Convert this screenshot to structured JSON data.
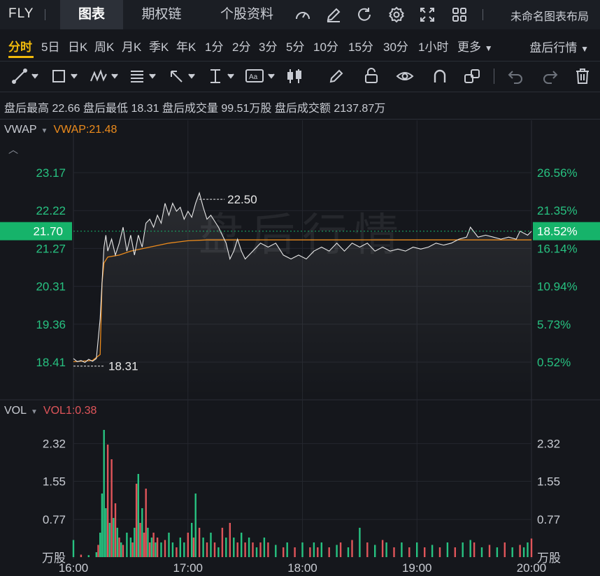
{
  "ticker": "FLY",
  "tabs": [
    "图表",
    "期权链",
    "个股资料"
  ],
  "layout_name": "未命名图表布局",
  "periods": [
    "分时",
    "5日",
    "日K",
    "周K",
    "月K",
    "季K",
    "年K",
    "1分",
    "2分",
    "3分",
    "5分",
    "10分",
    "15分",
    "30分",
    "1小时",
    "更多"
  ],
  "active_period": "分时",
  "after_hours_label": "盘后行情",
  "stats": [
    {
      "label": "盘后最高",
      "value": "22.66"
    },
    {
      "label": "盘后最低",
      "value": "18.31"
    },
    {
      "label": "盘后成交量",
      "value": "99.51万股"
    },
    {
      "label": "盘后成交额",
      "value": "2137.87万"
    }
  ],
  "indicators": {
    "price": {
      "name": "VWAP",
      "value_label": "VWAP:21.48"
    },
    "volume": {
      "name": "VOL",
      "value_label": "VOL1:0.38"
    }
  },
  "watermark": "盘后行情",
  "icons": {
    "top": [
      "gauge-icon",
      "edit-icon",
      "refresh-icon",
      "settings-icon",
      "fullscreen-icon",
      "grid-layout-icon"
    ],
    "tools": [
      "trendline-icon",
      "rectangle-icon",
      "wave-icon",
      "fib-icon",
      "arrow-icon",
      "measure-icon",
      "text-icon",
      "candle-icon",
      "pen-icon",
      "lock-icon",
      "eye-icon",
      "magnet-icon",
      "link-icon",
      "undo-icon",
      "redo-icon",
      "trash-icon"
    ]
  },
  "colors": {
    "accent": "#f0b90b",
    "up": "#27c281",
    "down": "#e0555a",
    "vwap": "#ec8b1c",
    "price_line": "#e8e8e8",
    "current_price_tag": "#16b36a"
  },
  "chart_data": {
    "type": "line",
    "x_ticks": [
      "16:00",
      "17:00",
      "18:00",
      "19:00",
      "20:00"
    ],
    "y_ticks_left": [
      "23.17",
      "22.22",
      "21.27",
      "20.31",
      "19.36",
      "18.41"
    ],
    "y_ticks_right": [
      "26.56%",
      "21.35%",
      "16.14%",
      "10.94%",
      "5.73%",
      "0.52%"
    ],
    "ylim": [
      18.41,
      23.17
    ],
    "last_price": "21.70",
    "last_pct": "18.52%",
    "high_label": "22.50",
    "low_label": "18.31",
    "series": [
      {
        "name": "price",
        "points": [
          [
            "16:00",
            18.5
          ],
          [
            "16:02",
            18.42
          ],
          [
            "16:04",
            18.45
          ],
          [
            "16:06",
            18.4
          ],
          [
            "16:08",
            18.48
          ],
          [
            "16:10",
            18.43
          ],
          [
            "16:12",
            18.5
          ],
          [
            "16:14",
            19.5
          ],
          [
            "16:15",
            20.4
          ],
          [
            "16:16",
            21.3
          ],
          [
            "16:17",
            21.6
          ],
          [
            "16:18",
            21.2
          ],
          [
            "16:20",
            21.5
          ],
          [
            "16:22",
            21.1
          ],
          [
            "16:24",
            21.4
          ],
          [
            "16:26",
            21.8
          ],
          [
            "16:28",
            21.2
          ],
          [
            "16:30",
            21.6
          ],
          [
            "16:32",
            21.1
          ],
          [
            "16:34",
            21.6
          ],
          [
            "16:36",
            21.3
          ],
          [
            "16:38",
            21.9
          ],
          [
            "16:40",
            22.0
          ],
          [
            "16:42",
            21.8
          ],
          [
            "16:44",
            22.1
          ],
          [
            "16:46",
            21.9
          ],
          [
            "16:48",
            22.4
          ],
          [
            "16:50",
            22.1
          ],
          [
            "16:52",
            22.4
          ],
          [
            "16:54",
            22.2
          ],
          [
            "16:56",
            22.3
          ],
          [
            "16:58",
            22.0
          ],
          [
            "17:00",
            22.2
          ],
          [
            "17:02",
            22.05
          ],
          [
            "17:04",
            22.4
          ],
          [
            "17:06",
            22.66
          ],
          [
            "17:08",
            22.3
          ],
          [
            "17:10",
            22.0
          ],
          [
            "17:12",
            22.1
          ],
          [
            "17:14",
            21.95
          ],
          [
            "17:16",
            21.8
          ],
          [
            "17:18",
            21.6
          ],
          [
            "17:20",
            21.4
          ],
          [
            "17:22",
            21.0
          ],
          [
            "17:24",
            21.2
          ],
          [
            "17:26",
            21.5
          ],
          [
            "17:28",
            21.2
          ],
          [
            "17:30",
            21.0
          ],
          [
            "17:34",
            21.2
          ],
          [
            "17:38",
            21.4
          ],
          [
            "17:42",
            21.3
          ],
          [
            "17:46",
            21.4
          ],
          [
            "17:50",
            21.1
          ],
          [
            "17:54",
            21.0
          ],
          [
            "17:58",
            21.1
          ],
          [
            "18:02",
            21.0
          ],
          [
            "18:06",
            21.2
          ],
          [
            "18:10",
            21.3
          ],
          [
            "18:14",
            21.2
          ],
          [
            "18:18",
            21.4
          ],
          [
            "18:22",
            21.2
          ],
          [
            "18:26",
            21.4
          ],
          [
            "18:30",
            21.3
          ],
          [
            "18:34",
            21.4
          ],
          [
            "18:38",
            21.2
          ],
          [
            "18:42",
            21.3
          ],
          [
            "18:46",
            21.2
          ],
          [
            "18:50",
            21.25
          ],
          [
            "18:54",
            21.2
          ],
          [
            "18:58",
            21.3
          ],
          [
            "19:02",
            21.25
          ],
          [
            "19:06",
            21.3
          ],
          [
            "19:10",
            21.4
          ],
          [
            "19:14",
            21.35
          ],
          [
            "19:18",
            21.4
          ],
          [
            "19:22",
            21.5
          ],
          [
            "19:26",
            21.55
          ],
          [
            "19:28",
            21.8
          ],
          [
            "19:32",
            21.55
          ],
          [
            "19:36",
            21.6
          ],
          [
            "19:40",
            21.55
          ],
          [
            "19:44",
            21.5
          ],
          [
            "19:48",
            21.55
          ],
          [
            "19:52",
            21.5
          ],
          [
            "19:54",
            21.7
          ],
          [
            "19:58",
            21.6
          ],
          [
            "20:00",
            21.7
          ]
        ]
      },
      {
        "name": "VWAP",
        "points": [
          [
            "16:00",
            18.42
          ],
          [
            "16:10",
            18.45
          ],
          [
            "16:14",
            18.6
          ],
          [
            "16:15",
            20.4
          ],
          [
            "16:16",
            20.9
          ],
          [
            "16:18",
            21.05
          ],
          [
            "16:24",
            21.1
          ],
          [
            "16:30",
            21.2
          ],
          [
            "16:40",
            21.3
          ],
          [
            "16:50",
            21.4
          ],
          [
            "17:00",
            21.46
          ],
          [
            "17:10",
            21.48
          ],
          [
            "18:00",
            21.48
          ],
          [
            "19:00",
            21.48
          ],
          [
            "20:00",
            21.48
          ]
        ]
      }
    ],
    "volume": {
      "unit": "万股",
      "y_ticks": [
        "2.32",
        "1.55",
        "0.77"
      ],
      "ylim": [
        0,
        2.8
      ],
      "bars": [
        [
          "16:00",
          0.35,
          "up"
        ],
        [
          "16:04",
          0.05,
          "down"
        ],
        [
          "16:08",
          0.04,
          "up"
        ],
        [
          "16:12",
          0.1,
          "up"
        ],
        [
          "16:13",
          0.25,
          "down"
        ],
        [
          "16:14",
          0.5,
          "up"
        ],
        [
          "16:15",
          1.3,
          "up"
        ],
        [
          "16:16",
          2.6,
          "up"
        ],
        [
          "16:17",
          1.0,
          "up"
        ],
        [
          "16:18",
          2.3,
          "down"
        ],
        [
          "16:19",
          0.7,
          "up"
        ],
        [
          "16:20",
          2.0,
          "down"
        ],
        [
          "16:21",
          0.8,
          "up"
        ],
        [
          "16:22",
          1.1,
          "down"
        ],
        [
          "16:23",
          0.6,
          "up"
        ],
        [
          "16:24",
          0.4,
          "down"
        ],
        [
          "16:25",
          0.3,
          "up"
        ],
        [
          "16:26",
          0.25,
          "down"
        ],
        [
          "16:28",
          0.5,
          "up"
        ],
        [
          "16:30",
          0.4,
          "up"
        ],
        [
          "16:31",
          0.3,
          "down"
        ],
        [
          "16:32",
          0.6,
          "up"
        ],
        [
          "16:33",
          1.5,
          "down"
        ],
        [
          "16:34",
          1.7,
          "up"
        ],
        [
          "16:35",
          0.7,
          "down"
        ],
        [
          "16:36",
          1.0,
          "up"
        ],
        [
          "16:37",
          0.5,
          "down"
        ],
        [
          "16:38",
          1.4,
          "down"
        ],
        [
          "16:39",
          0.6,
          "up"
        ],
        [
          "16:40",
          0.3,
          "down"
        ],
        [
          "16:41",
          0.4,
          "up"
        ],
        [
          "16:42",
          0.5,
          "down"
        ],
        [
          "16:43",
          0.3,
          "up"
        ],
        [
          "16:44",
          0.4,
          "down"
        ],
        [
          "16:46",
          0.3,
          "up"
        ],
        [
          "16:48",
          0.35,
          "down"
        ],
        [
          "16:50",
          0.5,
          "up"
        ],
        [
          "16:52",
          0.3,
          "up"
        ],
        [
          "16:54",
          0.2,
          "down"
        ],
        [
          "16:56",
          0.4,
          "up"
        ],
        [
          "16:58",
          0.3,
          "up"
        ],
        [
          "17:00",
          0.5,
          "down"
        ],
        [
          "17:02",
          0.7,
          "up"
        ],
        [
          "17:03",
          0.4,
          "down"
        ],
        [
          "17:04",
          1.3,
          "up"
        ],
        [
          "17:06",
          0.6,
          "down"
        ],
        [
          "17:08",
          0.4,
          "up"
        ],
        [
          "17:10",
          0.3,
          "down"
        ],
        [
          "17:12",
          0.5,
          "up"
        ],
        [
          "17:14",
          0.3,
          "down"
        ],
        [
          "17:16",
          0.2,
          "up"
        ],
        [
          "17:18",
          0.6,
          "down"
        ],
        [
          "17:20",
          0.4,
          "up"
        ],
        [
          "17:22",
          0.7,
          "down"
        ],
        [
          "17:24",
          0.4,
          "up"
        ],
        [
          "17:26",
          0.3,
          "down"
        ],
        [
          "17:28",
          0.5,
          "up"
        ],
        [
          "17:30",
          0.3,
          "down"
        ],
        [
          "17:32",
          0.4,
          "up"
        ],
        [
          "17:34",
          0.3,
          "down"
        ],
        [
          "17:36",
          0.2,
          "up"
        ],
        [
          "17:38",
          0.3,
          "down"
        ],
        [
          "17:40",
          0.4,
          "up"
        ],
        [
          "17:42",
          0.3,
          "down"
        ],
        [
          "17:46",
          0.25,
          "up"
        ],
        [
          "17:50",
          0.2,
          "down"
        ],
        [
          "17:52",
          0.3,
          "up"
        ],
        [
          "17:56",
          0.2,
          "down"
        ],
        [
          "18:00",
          0.3,
          "up"
        ],
        [
          "18:04",
          0.2,
          "down"
        ],
        [
          "18:06",
          0.3,
          "up"
        ],
        [
          "18:08",
          0.2,
          "down"
        ],
        [
          "18:10",
          0.3,
          "up"
        ],
        [
          "18:14",
          0.2,
          "down"
        ],
        [
          "18:18",
          0.25,
          "up"
        ],
        [
          "18:20",
          0.3,
          "down"
        ],
        [
          "18:24",
          0.2,
          "up"
        ],
        [
          "18:26",
          0.35,
          "down"
        ],
        [
          "18:30",
          0.6,
          "up"
        ],
        [
          "18:34",
          0.3,
          "down"
        ],
        [
          "18:38",
          0.25,
          "up"
        ],
        [
          "18:42",
          0.35,
          "down"
        ],
        [
          "18:44",
          0.3,
          "up"
        ],
        [
          "18:48",
          0.2,
          "down"
        ],
        [
          "18:52",
          0.3,
          "up"
        ],
        [
          "18:56",
          0.2,
          "down"
        ],
        [
          "19:00",
          0.3,
          "up"
        ],
        [
          "19:04",
          0.2,
          "down"
        ],
        [
          "19:08",
          0.25,
          "up"
        ],
        [
          "19:12",
          0.2,
          "down"
        ],
        [
          "19:16",
          0.3,
          "up"
        ],
        [
          "19:20",
          0.2,
          "down"
        ],
        [
          "19:24",
          0.3,
          "up"
        ],
        [
          "19:28",
          0.35,
          "up"
        ],
        [
          "19:30",
          0.3,
          "down"
        ],
        [
          "19:34",
          0.2,
          "up"
        ],
        [
          "19:38",
          0.25,
          "down"
        ],
        [
          "19:42",
          0.2,
          "up"
        ],
        [
          "19:46",
          0.3,
          "down"
        ],
        [
          "19:50",
          0.2,
          "up"
        ],
        [
          "19:54",
          0.25,
          "down"
        ],
        [
          "19:56",
          0.2,
          "up"
        ],
        [
          "19:58",
          0.3,
          "up"
        ],
        [
          "20:00",
          0.38,
          "down"
        ]
      ]
    }
  }
}
